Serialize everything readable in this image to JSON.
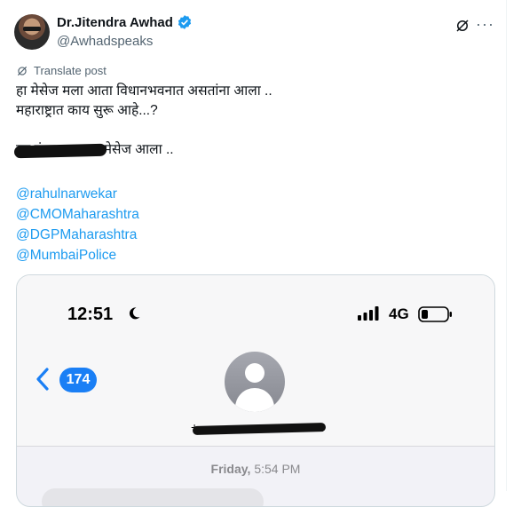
{
  "tweet": {
    "author": {
      "display_name": "Dr.Jitendra Awhad",
      "handle": "@Awhadspeaks",
      "verified": true
    },
    "translate_label": "Translate post",
    "text_lines": "हा मेसेज मला आता विधानभवनात असतांना आला ..\nमहाराष्ट्रात काय सुरू आहे...?\n\n              ह्या नंबर वरून हा मेसेज आला ..",
    "mentions": [
      "@rahulnarwekar",
      "@CMOMaharashtra",
      "@DGPMaharashtra",
      "@MumbaiPolice"
    ],
    "colors": {
      "link": "#1d9bf0",
      "secondary_text": "#536471",
      "accent": "#1a7ff5"
    }
  },
  "screenshot": {
    "status_bar": {
      "time": "12:51",
      "network": "4G"
    },
    "back_count": "174",
    "contact_number": "+",
    "date_stamp_day": "Friday,",
    "date_stamp_time": "5:54 PM"
  }
}
